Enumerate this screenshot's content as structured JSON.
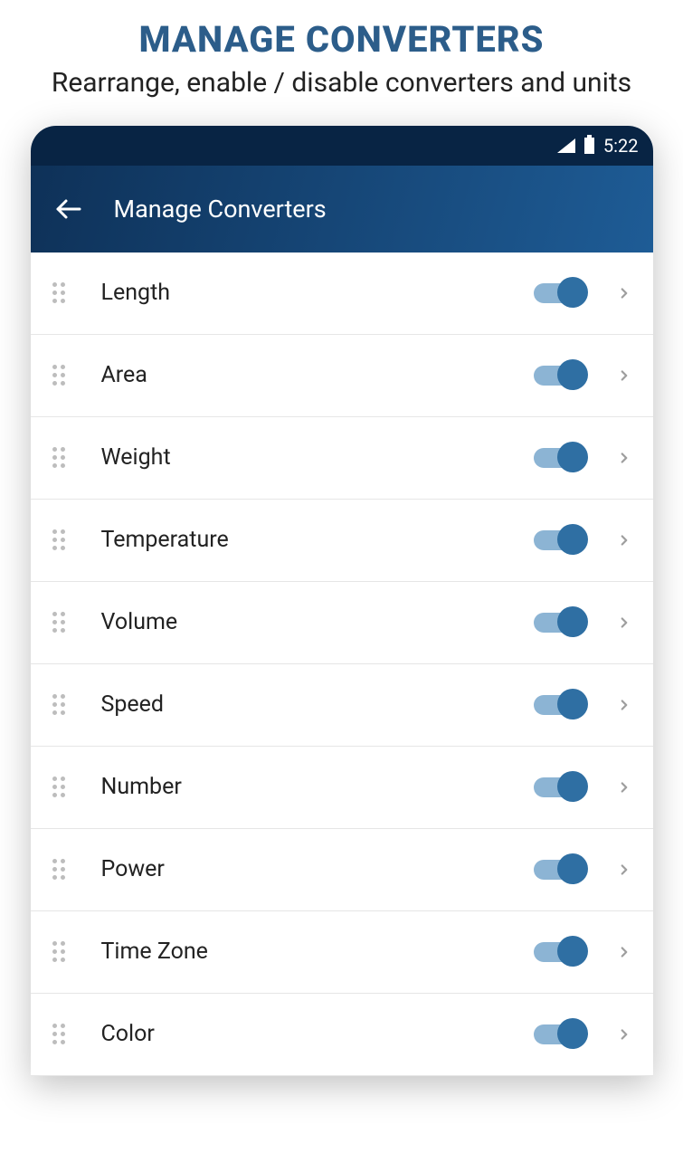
{
  "promo": {
    "title": "MANAGE CONVERTERS",
    "subtitle": "Rearrange, enable / disable converters and units"
  },
  "status": {
    "time": "5:22"
  },
  "appbar": {
    "title": "Manage Converters"
  },
  "rows": [
    {
      "label": "Length",
      "enabled": true
    },
    {
      "label": "Area",
      "enabled": true
    },
    {
      "label": "Weight",
      "enabled": true
    },
    {
      "label": "Temperature",
      "enabled": true
    },
    {
      "label": "Volume",
      "enabled": true
    },
    {
      "label": "Speed",
      "enabled": true
    },
    {
      "label": "Number",
      "enabled": true
    },
    {
      "label": "Power",
      "enabled": true
    },
    {
      "label": "Time Zone",
      "enabled": true
    },
    {
      "label": "Color",
      "enabled": true
    }
  ]
}
